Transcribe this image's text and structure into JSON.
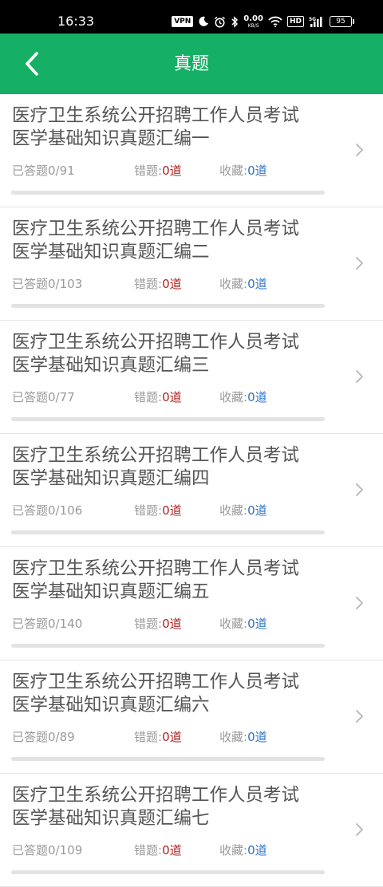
{
  "status_bar": {
    "time": "16:33",
    "vpn": "VPN",
    "speed_value": "0.00",
    "speed_unit": "KB/S",
    "hd": "HD",
    "network": "5G",
    "battery": "95",
    "icons": [
      "moon-icon",
      "alarm-icon",
      "bluetooth-icon",
      "wifi-icon",
      "signal-icon",
      "battery-icon"
    ]
  },
  "header": {
    "title": "真题",
    "background": "#15b065"
  },
  "labels": {
    "answered": "已答题",
    "wrong": "错题:",
    "favorite": "收藏:",
    "unit": "道"
  },
  "items": [
    {
      "line1": "医疗卫生系统公开招聘工作人员考试",
      "line2": "医学基础知识真题汇编一",
      "answered": "0/91",
      "wrong": "0",
      "favorite": "0",
      "progress": 0
    },
    {
      "line1": "医疗卫生系统公开招聘工作人员考试",
      "line2": "医学基础知识真题汇编二",
      "answered": "0/103",
      "wrong": "0",
      "favorite": "0",
      "progress": 0
    },
    {
      "line1": "医疗卫生系统公开招聘工作人员考试",
      "line2": "医学基础知识真题汇编三",
      "answered": "0/77",
      "wrong": "0",
      "favorite": "0",
      "progress": 0
    },
    {
      "line1": "医疗卫生系统公开招聘工作人员考试",
      "line2": "医学基础知识真题汇编四",
      "answered": "0/106",
      "wrong": "0",
      "favorite": "0",
      "progress": 0
    },
    {
      "line1": "医疗卫生系统公开招聘工作人员考试",
      "line2": "医学基础知识真题汇编五",
      "answered": "0/140",
      "wrong": "0",
      "favorite": "0",
      "progress": 0
    },
    {
      "line1": "医疗卫生系统公开招聘工作人员考试",
      "line2": "医学基础知识真题汇编六",
      "answered": "0/89",
      "wrong": "0",
      "favorite": "0",
      "progress": 0
    },
    {
      "line1": "医疗卫生系统公开招聘工作人员考试",
      "line2": "医学基础知识真题汇编七",
      "answered": "0/109",
      "wrong": "0",
      "favorite": "0",
      "progress": 0
    }
  ]
}
